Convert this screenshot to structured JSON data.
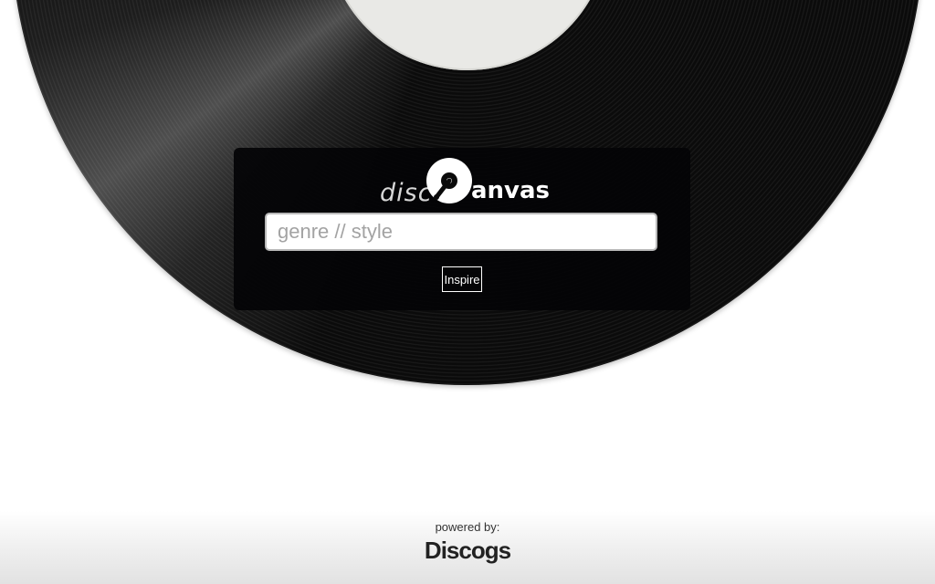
{
  "logo": {
    "disc_text": "disc",
    "icon": "vinyl-record-icon",
    "anvas_text": "anvas"
  },
  "search": {
    "placeholder": "genre // style",
    "value": ""
  },
  "actions": {
    "inspire_label": "Inspire"
  },
  "footer": {
    "powered_by": "powered by:",
    "brand": "Discogs"
  },
  "colors": {
    "record": "#0b0b0b",
    "label": "#e9e9e6",
    "panel": "#040406",
    "button_border": "#ffffff"
  }
}
